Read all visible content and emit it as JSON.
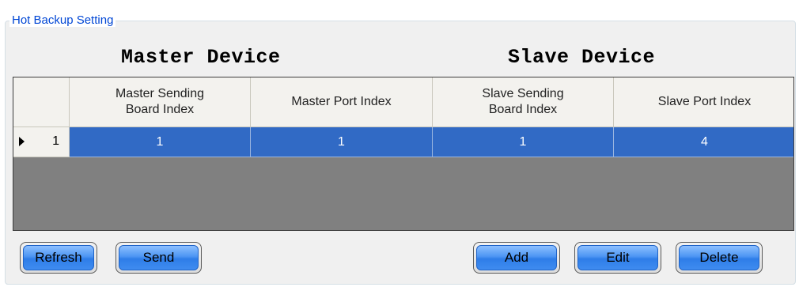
{
  "group": {
    "title": "Hot Backup Setting"
  },
  "headings": {
    "master": "Master Device",
    "slave": "Slave Device"
  },
  "grid": {
    "columns": [
      "Master Sending\nBoard Index",
      "Master Port Index",
      "Slave Sending\nBoard Index",
      "Slave Port Index"
    ],
    "rows": [
      {
        "index": "1",
        "cells": [
          "1",
          "1",
          "1",
          "4"
        ]
      }
    ]
  },
  "buttons": {
    "refresh": "Refresh",
    "send": "Send",
    "add": "Add",
    "edit": "Edit",
    "delete": "Delete"
  },
  "colors": {
    "title": "#0046d5",
    "selected_row": "#316ac5",
    "grid_empty": "#808080",
    "button_blue": "#3f8cf0"
  }
}
